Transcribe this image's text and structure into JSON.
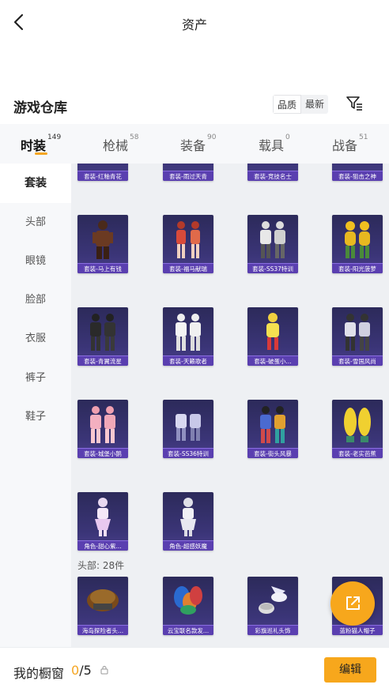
{
  "header": {
    "title": "资产",
    "back_icon": "chevron-left-icon"
  },
  "section": {
    "title": "游戏仓库",
    "sort_options": [
      "品质",
      "最新"
    ],
    "sort_selected": "品质",
    "filter_icon": "filter-icon"
  },
  "tabs": [
    {
      "label": "时装",
      "count": "149",
      "active": true
    },
    {
      "label": "枪械",
      "count": "58",
      "active": false
    },
    {
      "label": "装备",
      "count": "90",
      "active": false
    },
    {
      "label": "载具",
      "count": "0",
      "active": false
    },
    {
      "label": "战备",
      "count": "51",
      "active": false
    }
  ],
  "sidebar": {
    "items": [
      {
        "label": "套装",
        "active": true
      },
      {
        "label": "头部",
        "active": false
      },
      {
        "label": "眼镜",
        "active": false
      },
      {
        "label": "脸部",
        "active": false
      },
      {
        "label": "衣服",
        "active": false
      },
      {
        "label": "裤子",
        "active": false
      },
      {
        "label": "鞋子",
        "active": false
      }
    ]
  },
  "items": {
    "suits_row0": [
      "套装-红釉青花",
      "套装-雨过天青",
      "套装-竞技名士",
      "套装-狙击之神"
    ],
    "suits_row1": [
      "套装-马上有钱",
      "套装-福马献瑞",
      "套装-SS37特训",
      "套装-阳光菠萝"
    ],
    "suits_row2": [
      "套装-青翼流星",
      "套装-天籁歌者",
      "套装-破蛋小...",
      "套装-雪国风尚"
    ],
    "suits_row3": [
      "套装-城堡小鹅",
      "套装-SS36特训",
      "套装-街头风暴",
      "套装-老实芭蕉"
    ],
    "suits_row4": [
      "角色-甜心紫...",
      "角色-超感妖魔"
    ],
    "head_group_header": "头部: 28件",
    "head_row0": [
      "海岛探险者头...",
      "云宝联名款发...",
      "彩旗巡礼头饰",
      "蓝粉猫人帽子"
    ]
  },
  "bottom_bar": {
    "showcase_label": "我的橱窗",
    "current": "0",
    "separator_total": "/5",
    "edit_label": "编辑"
  },
  "colors": {
    "accent": "#f7a71c",
    "card_bg": "#2c2a5a",
    "card_label": "#5a3fb0"
  }
}
